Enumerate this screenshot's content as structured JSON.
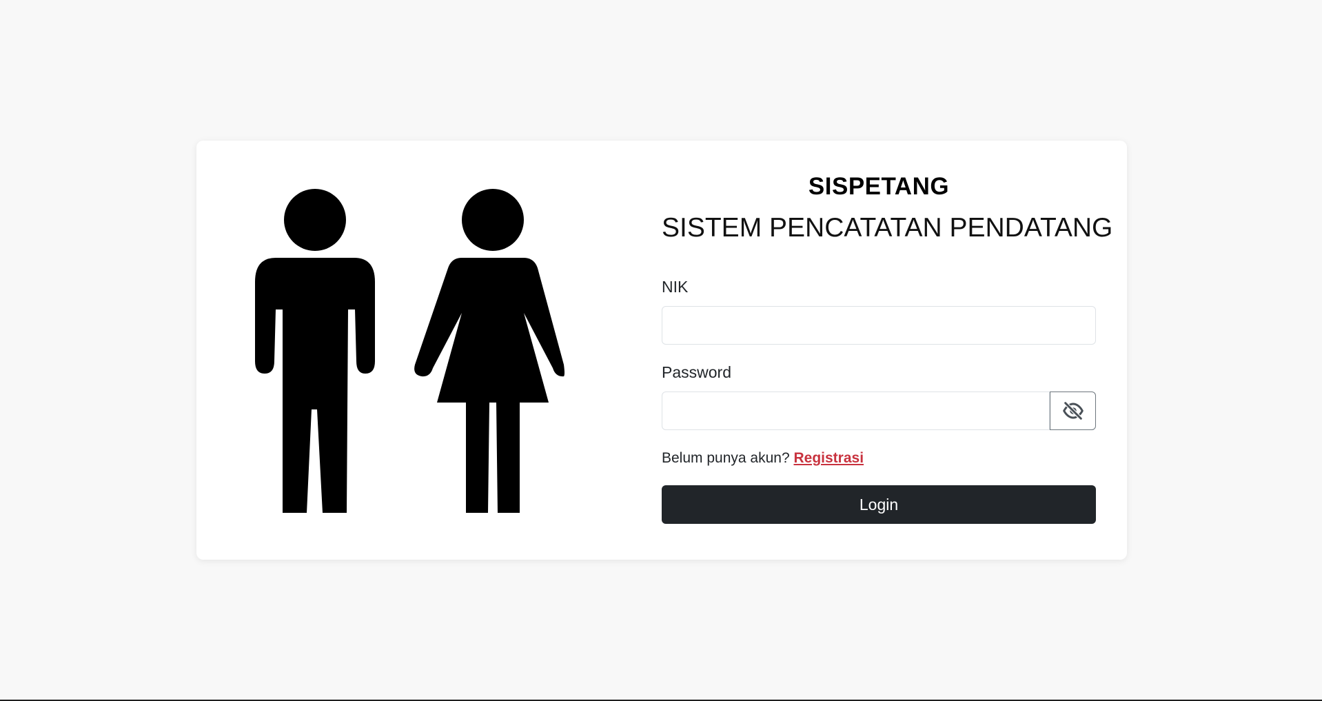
{
  "app": {
    "title": "SISPETANG",
    "subtitle": "SISTEM PENCATATAN PENDATANG"
  },
  "form": {
    "nik_label": "NIK",
    "nik_value": "",
    "password_label": "Password",
    "password_value": "",
    "toggle_icon": "eye-slash-icon",
    "register_prompt": "Belum punya akun?",
    "register_link": "Registrasi",
    "login_label": "Login"
  },
  "illustration": {
    "icon": "man-woman-pictogram"
  },
  "colors": {
    "background": "#f8f8f8",
    "card": "#ffffff",
    "button_dark": "#212529",
    "link_red": "#c8323e"
  }
}
